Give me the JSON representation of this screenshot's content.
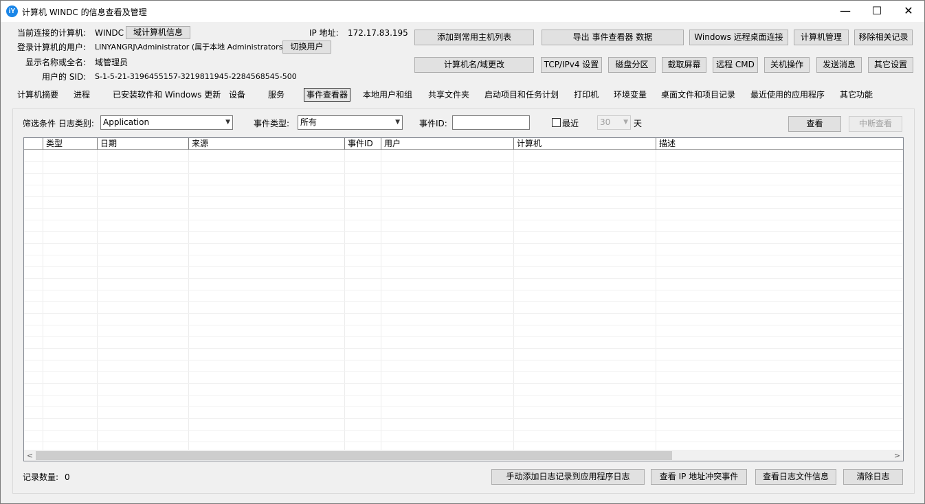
{
  "window": {
    "title": "计算机 WINDC 的信息查看及管理",
    "icon_text": "iY",
    "controls": {
      "minimize": "—",
      "maximize": "☐",
      "close": "✕"
    }
  },
  "info": {
    "computer_label": "当前连接的计算机:",
    "computer_value": "WINDC",
    "domain_info_button": "域计算机信息",
    "ip_label": "IP 地址:",
    "ip_value": "172.17.83.195",
    "user_label": "登录计算机的用户:",
    "user_value": "LINYANGRJ\\Administrator (属于本地 Administrators 组)",
    "switch_user_button": "切换用户",
    "display_name_label": "显示名称或全名:",
    "display_name_value": "域管理员",
    "sid_label": "用户的 SID:",
    "sid_value": "S-1-5-21-3196455157-3219811945-2284568545-500"
  },
  "actions_row1": {
    "add_host": "添加到常用主机列表",
    "export_events": "导出 事件查看器 数据",
    "remote_desktop": "Windows 远程桌面连接",
    "computer_manage": "计算机管理",
    "remove_records": "移除相关记录"
  },
  "actions_row2": {
    "rename": "计算机名/域更改",
    "tcpip": "TCP/IPv4 设置",
    "disk": "磁盘分区",
    "screenshot": "截取屏幕",
    "remote_cmd": "远程 CMD",
    "shutdown": "关机操作",
    "send_message": "发送消息",
    "other_settings": "其它设置"
  },
  "tabs": [
    "计算机摘要",
    "进程",
    "已安装软件和 Windows 更新",
    "设备",
    "服务",
    "事件查看器",
    "本地用户和组",
    "共享文件夹",
    "启动项目和任务计划",
    "打印机",
    "环境变量",
    "桌面文件和项目记录",
    "最近使用的应用程序",
    "其它功能"
  ],
  "active_tab": "事件查看器",
  "filter": {
    "log_type_label": "筛选条件 日志类别:",
    "log_type_value": "Application",
    "event_type_label": "事件类型:",
    "event_type_value": "所有",
    "event_id_label": "事件ID:",
    "event_id_value": "",
    "recent_label": "最近",
    "recent_checked": false,
    "days_value": "30",
    "days_unit": "天",
    "view_button": "查看",
    "stop_button": "中断查看"
  },
  "table": {
    "columns": [
      "",
      "类型",
      "日期",
      "来源",
      "事件ID",
      "用户",
      "计算机",
      "描述"
    ],
    "rows": []
  },
  "footer": {
    "record_count_label": "记录数量:",
    "record_count_value": "0",
    "manual_add": "手动添加日志记录到应用程序日志",
    "ip_conflict": "查看 IP 地址冲突事件",
    "log_file_info": "查看日志文件信息",
    "clear_log": "清除日志"
  }
}
